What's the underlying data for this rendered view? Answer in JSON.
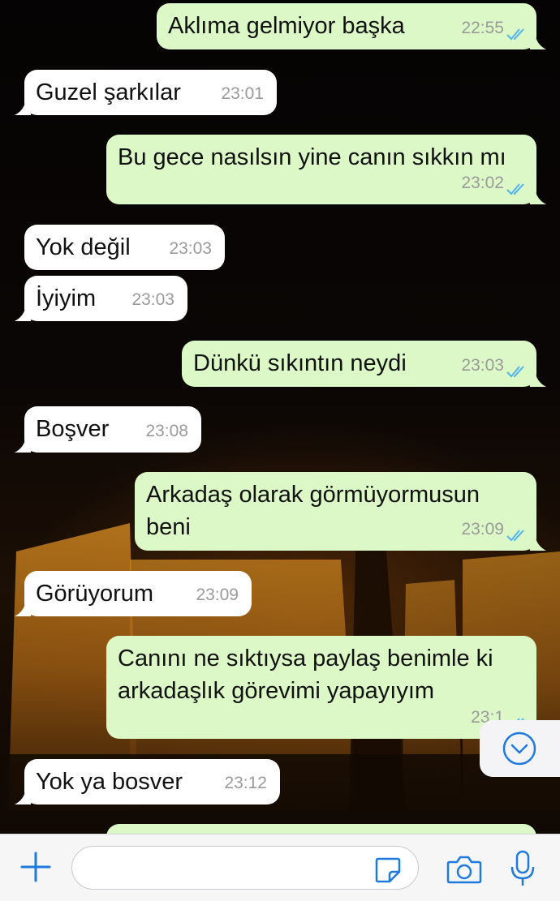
{
  "messages": [
    {
      "dir": "out",
      "text": "Aklıma gelmiyor başka",
      "time": "22:55",
      "read": true
    },
    {
      "dir": "in",
      "text": "Guzel şarkılar",
      "time": "23:01"
    },
    {
      "dir": "out",
      "text": "Bu gece nasılsın yine canın sıkkın mı",
      "time": "23:02",
      "read": true
    },
    {
      "dir": "in",
      "text": "Yok değil",
      "time": "23:03"
    },
    {
      "dir": "in",
      "text": "İyiyim",
      "time": "23:03"
    },
    {
      "dir": "out",
      "text": "Dünkü sıkıntın neydi",
      "time": "23:03",
      "read": true
    },
    {
      "dir": "in",
      "text": "Boşver",
      "time": "23:08"
    },
    {
      "dir": "out",
      "text": "Arkadaş olarak görmüyormusun\nbeni",
      "time": "23:09",
      "read": true
    },
    {
      "dir": "in",
      "text": "Görüyorum",
      "time": "23:09"
    },
    {
      "dir": "out",
      "text": "Canını ne sıktıysa paylaş benimle ki\narkadaşlık görevimi yapayıyım",
      "time": "23:1",
      "read": true
    },
    {
      "dir": "in",
      "text": "Yok ya bosver",
      "time": "23:12"
    }
  ],
  "composer": {
    "placeholder": ""
  },
  "icons": {
    "attach": "plus-icon",
    "sticker": "sticker-icon",
    "camera": "camera-icon",
    "mic": "microphone-icon",
    "scroll": "chevron-down-circle-icon",
    "read_receipt": "double-check-icon"
  },
  "colors": {
    "outgoing_bubble": "#dcf8c6",
    "incoming_bubble": "#ffffff",
    "accent": "#1f7ae0",
    "read_tick": "#4fb3f6"
  }
}
